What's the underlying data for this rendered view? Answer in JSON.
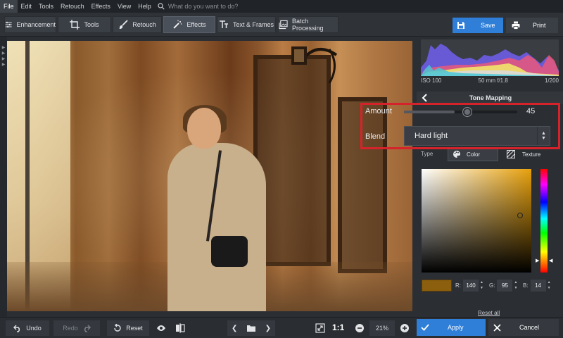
{
  "menu": {
    "items": [
      "File",
      "Edit",
      "Tools",
      "Retouch",
      "Effects",
      "View",
      "Help"
    ],
    "search_placeholder": "What do you want to do?"
  },
  "toolbar": {
    "tabs": [
      "Enhancement",
      "Tools",
      "Retouch",
      "Effects",
      "Text & Frames",
      "Batch Processing"
    ],
    "active_tab": "Effects",
    "save_label": "Save",
    "print_label": "Print"
  },
  "histogram": {
    "iso": "ISO 100",
    "lens": "50 mm f/1.8",
    "shutter": "1/200"
  },
  "panel": {
    "title": "Tone Mapping",
    "amount_label": "Amount",
    "amount_value": "45",
    "amount_fraction": 0.45,
    "blend_label": "Blend",
    "blend_value": "Hard light",
    "type_label": "Type",
    "type_color": "Color",
    "type_texture": "Texture",
    "r_label": "R:",
    "r_value": "140",
    "g_label": "G:",
    "g_value": "95",
    "b_label": "B:",
    "b_value": "14",
    "swatch_color": "#8c5f0e",
    "reset_all": "Reset all",
    "apply_label": "Apply",
    "cancel_label": "Cancel"
  },
  "bottom": {
    "undo_label": "Undo",
    "redo_label": "Redo",
    "reset_label": "Reset",
    "one_to_one": "1:1",
    "zoom": "21%"
  },
  "colors": {
    "accent": "#2f7fd8",
    "highlight": "#d6232b"
  }
}
